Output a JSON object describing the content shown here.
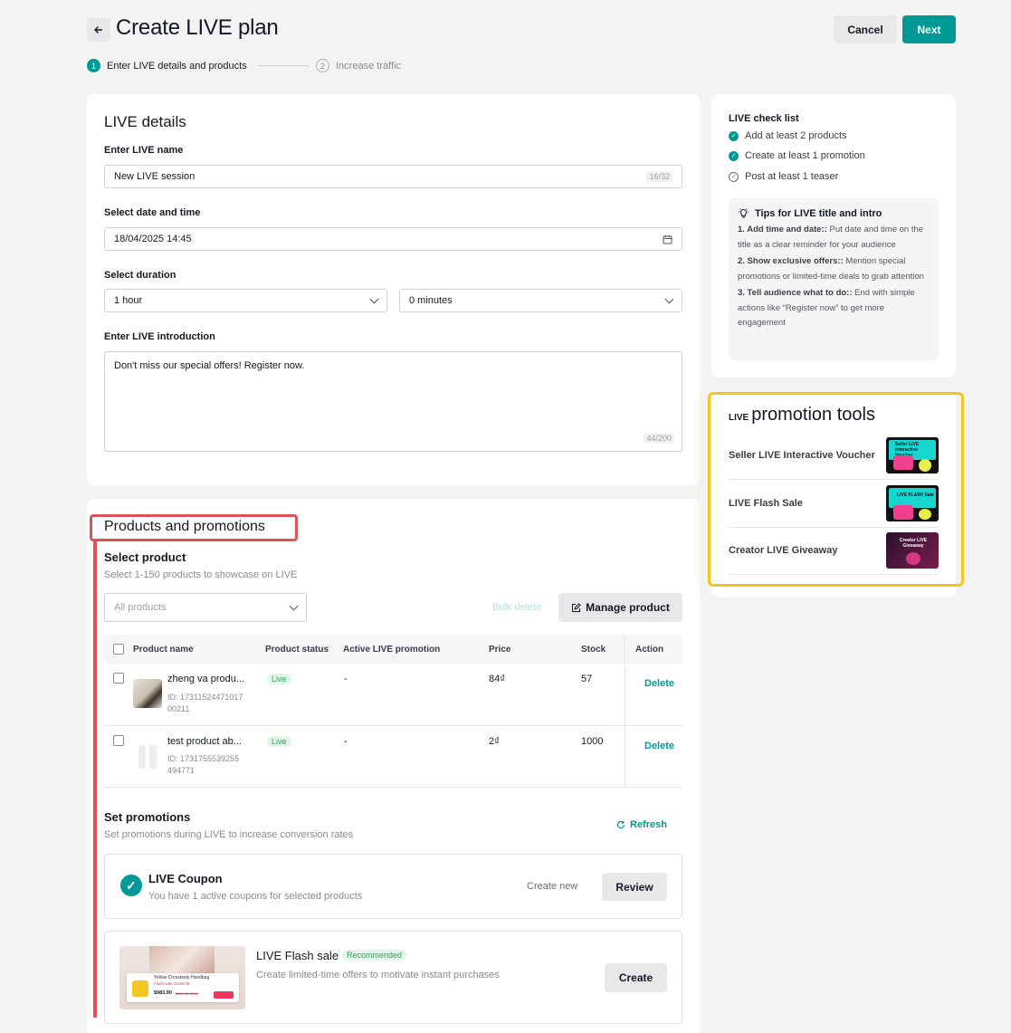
{
  "header": {
    "title": "Create LIVE plan",
    "cancel_label": "Cancel",
    "next_label": "Next"
  },
  "steps": [
    {
      "num": "1",
      "label": "Enter LIVE details and products"
    },
    {
      "num": "2",
      "label": "Increase traffic"
    }
  ],
  "details": {
    "title": "LIVE details",
    "name_label": "Enter LIVE name",
    "name_value": "New LIVE session",
    "name_counter": "16/32",
    "date_label": "Select date and time",
    "date_value": "18/04/2025 14:45",
    "duration_label": "Select duration",
    "duration_hours": "1 hour",
    "duration_minutes": "0 minutes",
    "intro_label": "Enter LIVE introduction",
    "intro_value": "Don't miss our special offers! Register now.",
    "intro_counter": "44/200"
  },
  "checklist": {
    "title": "LIVE check list",
    "items": [
      {
        "label": "Add at least 2 products",
        "done": true
      },
      {
        "label": "Create at least 1 promotion",
        "done": true
      },
      {
        "label": "Post at least 1 teaser",
        "done": false
      }
    ],
    "tips_title": "Tips for LIVE title and intro",
    "tips": [
      {
        "bold": "1. Add time and date::",
        "text": " Put date and time on the title as a clear reminder for your audience"
      },
      {
        "bold": "2. Show exclusive offers::",
        "text": " Mention special promotions or limited-time deals to grab attention"
      },
      {
        "bold": "3. Tell audience what to do::",
        "text": " End with simple actions like “Register now” to get more engagement"
      }
    ]
  },
  "tools": {
    "prefix": "LIVE",
    "title": "promotion tools",
    "items": [
      {
        "label": "Seller LIVE Interactive Voucher",
        "thumb_text": "Seller LIVE Interactive Voucher"
      },
      {
        "label": "LIVE Flash Sale",
        "thumb_text": "LIVE FLASH Sale"
      },
      {
        "label": "Creator LIVE Giveaway",
        "thumb_text": "Creator LIVE Giveaway"
      }
    ]
  },
  "products": {
    "title": "Products and promotions",
    "select_title": "Select product",
    "select_sub": "Select 1-150 products to showcase on LIVE",
    "filter_placeholder": "All products",
    "bulk_delete": "Bulk delete",
    "manage_label": "Manage product",
    "columns": [
      "Product name",
      "Product status",
      "Active LIVE promotion",
      "Price",
      "Stock",
      "Action"
    ],
    "rows": [
      {
        "name": "zheng va produ...",
        "id_line1": "ID: 17311524471017",
        "id_line2": "00211",
        "status": "Live",
        "promotion": "-",
        "price": "84₫",
        "stock": "57",
        "action": "Delete"
      },
      {
        "name": "test product ab...",
        "id_line1": "ID: 1731755539255",
        "id_line2": "494771",
        "status": "Live",
        "promotion": "-",
        "price": "2₫",
        "stock": "1000",
        "action": "Delete"
      }
    ],
    "promotions_title": "Set promotions",
    "promotions_sub": "Set promotions during LIVE to increase conversion rates",
    "refresh_label": "Refresh",
    "coupon_title": "LIVE Coupon",
    "coupon_sub": "You have 1 active coupons for selected products",
    "coupon_create": "Create new",
    "coupon_review": "Review",
    "flash_title": "LIVE Flash sale",
    "flash_badge": "Recommended",
    "flash_sub": "Create limited-time offers to motivate instant purchases",
    "flash_create": "Create",
    "flash_thumb_product": "Yellow Crossbody Handbag",
    "flash_thumb_timer": "Flash sale 23:59:59",
    "flash_thumb_price": "$983.90",
    "flash_thumb_old_price": "$999.00 -20%"
  },
  "colors": {
    "primary": "#009995",
    "highlight_yellow": "#f6c41f",
    "highlight_red": "#e05259"
  }
}
